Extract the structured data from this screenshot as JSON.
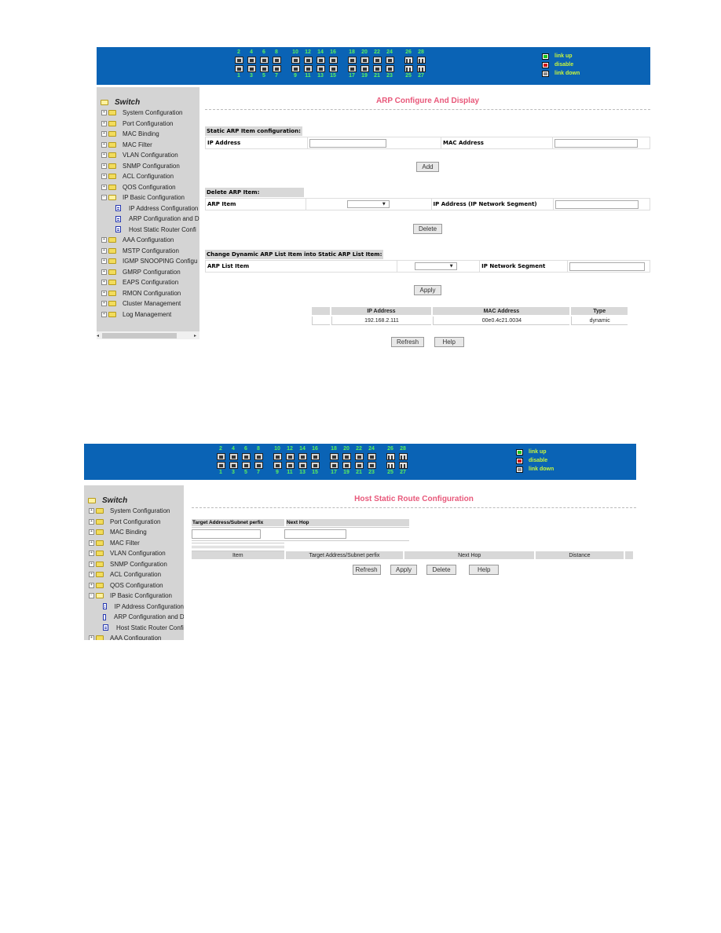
{
  "colors": {
    "header_bg": "#0a63b5",
    "port_number": "#5cf05c",
    "legend_text": "#c8f53c",
    "title": "#e8587a",
    "sidebar_bg": "#d4d4d4",
    "link_up": "#19c419",
    "disable": "#d41414",
    "link_down": "#888888"
  },
  "ports": {
    "groups": [
      [
        {
          "top": "2",
          "bottom": "1"
        },
        {
          "top": "4",
          "bottom": "3"
        },
        {
          "top": "6",
          "bottom": "5"
        },
        {
          "top": "8",
          "bottom": "7"
        }
      ],
      [
        {
          "top": "10",
          "bottom": "9"
        },
        {
          "top": "12",
          "bottom": "11"
        },
        {
          "top": "14",
          "bottom": "13"
        },
        {
          "top": "16",
          "bottom": "15"
        }
      ],
      [
        {
          "top": "18",
          "bottom": "17"
        },
        {
          "top": "20",
          "bottom": "19"
        },
        {
          "top": "22",
          "bottom": "21"
        },
        {
          "top": "24",
          "bottom": "23"
        }
      ],
      [
        {
          "top": "26",
          "bottom": "25",
          "fiber": true
        },
        {
          "top": "28",
          "bottom": "27",
          "fiber": true
        }
      ]
    ]
  },
  "legend": [
    {
      "icon": "link-up-icon",
      "label": "link up"
    },
    {
      "icon": "disable-icon",
      "label": "disable"
    },
    {
      "icon": "link-down-icon",
      "label": "link down"
    }
  ],
  "screen1": {
    "sidebar": {
      "root": "Switch",
      "items": [
        {
          "label": "System Configuration",
          "type": "folder"
        },
        {
          "label": "Port Configuration",
          "type": "folder"
        },
        {
          "label": "MAC Binding",
          "type": "folder"
        },
        {
          "label": "MAC Filter",
          "type": "folder"
        },
        {
          "label": "VLAN Configuration",
          "type": "folder"
        },
        {
          "label": "SNMP Configuration",
          "type": "folder"
        },
        {
          "label": "ACL Configuration",
          "type": "folder"
        },
        {
          "label": "QOS Configuration",
          "type": "folder"
        },
        {
          "label": "IP Basic Configuration",
          "type": "folder-open"
        },
        {
          "label": "IP Address Configuration",
          "type": "doc"
        },
        {
          "label": "ARP Configuration and D",
          "type": "doc"
        },
        {
          "label": "Host Static Router Confi",
          "type": "doc"
        },
        {
          "label": "AAA Configuration",
          "type": "folder"
        },
        {
          "label": "MSTP Configuration",
          "type": "folder"
        },
        {
          "label": "IGMP SNOOPING Configu",
          "type": "folder"
        },
        {
          "label": "GMRP Configuration",
          "type": "folder"
        },
        {
          "label": "EAPS Configuration",
          "type": "folder"
        },
        {
          "label": "RMON Configuration",
          "type": "folder"
        },
        {
          "label": "Cluster Management",
          "type": "folder"
        },
        {
          "label": "Log Management",
          "type": "folder"
        }
      ]
    },
    "title": "ARP Configure And Display",
    "static_section": {
      "heading": "Static ARP Item configuration:",
      "ip_label": "IP Address",
      "ip_value": "",
      "mac_label": "MAC Address",
      "mac_value": "",
      "add_button": "Add"
    },
    "delete_section": {
      "heading": "Delete ARP Item:",
      "item_label": "ARP Item",
      "item_selected": "",
      "ip_label": "IP Address  (IP Network Segment)",
      "ip_value": "",
      "delete_button": "Delete"
    },
    "change_section": {
      "heading": "Change Dynamic ARP List Item into Static ARP List Item:",
      "item_label": "ARP List Item",
      "item_selected": "",
      "segment_label": "IP Network Segment",
      "segment_value": "",
      "apply_button": "Apply"
    },
    "arp_table": {
      "columns": [
        "",
        "IP Address",
        "MAC Address",
        "Type"
      ],
      "rows": [
        [
          "",
          "192.168.2.111",
          "00e0.4c21.0034",
          "dynamic"
        ]
      ]
    },
    "refresh_button": "Refresh",
    "help_button": "Help"
  },
  "screen2": {
    "sidebar": {
      "root": "Switch",
      "items": [
        {
          "label": "System Configuration",
          "type": "folder"
        },
        {
          "label": "Port Configuration",
          "type": "folder"
        },
        {
          "label": "MAC Binding",
          "type": "folder"
        },
        {
          "label": "MAC Filter",
          "type": "folder"
        },
        {
          "label": "VLAN Configuration",
          "type": "folder"
        },
        {
          "label": "SNMP Configuration",
          "type": "folder"
        },
        {
          "label": "ACL Configuration",
          "type": "folder"
        },
        {
          "label": "QOS Configuration",
          "type": "folder"
        },
        {
          "label": "IP Basic Configuration",
          "type": "folder-open"
        },
        {
          "label": "IP Address Configuration",
          "type": "doc"
        },
        {
          "label": "ARP Configuration and D",
          "type": "doc"
        },
        {
          "label": "Host Static Router Confi",
          "type": "doc"
        },
        {
          "label": "AAA Configuration",
          "type": "folder"
        }
      ]
    },
    "title": "Host Static Route Configuration",
    "form": {
      "target_label": "Target Address/Subnet perfix",
      "target_value": "",
      "nexthop_label": "Next Hop",
      "nexthop_value": ""
    },
    "route_table": {
      "columns": [
        "Item",
        "Target Address/Subnet perfix",
        "Next Hop",
        "Distance",
        ""
      ],
      "rows": []
    },
    "buttons": {
      "refresh": "Refresh",
      "apply": "Apply",
      "delete": "Delete",
      "help": "Help"
    }
  }
}
